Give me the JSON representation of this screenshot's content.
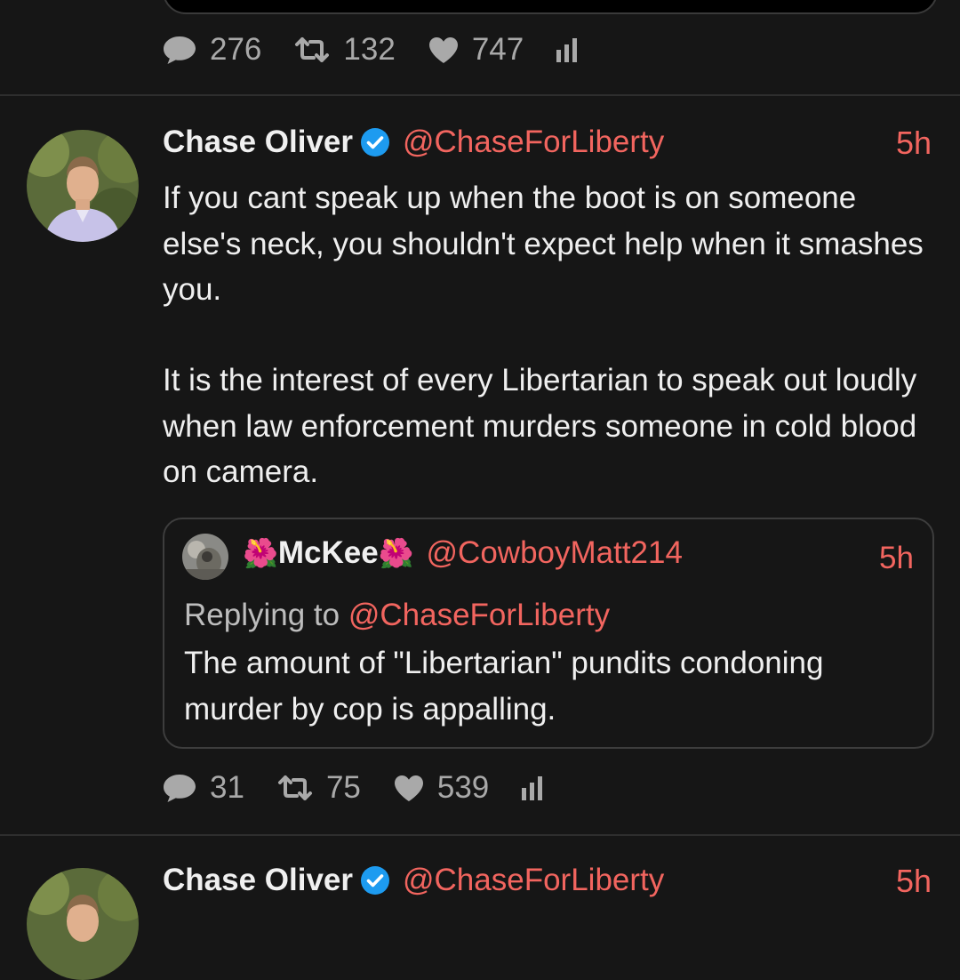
{
  "prev_tweet": {
    "stats": {
      "replies": "276",
      "retweets": "132",
      "likes": "747"
    }
  },
  "tweet": {
    "author_name": "Chase Oliver",
    "handle": "@ChaseForLiberty",
    "time": "5h",
    "verified": true,
    "text_p1": "If you cant speak up when the boot is on someone else's neck, you shouldn't expect help when it smashes you.",
    "text_p2": "It is the interest of every Libertarian to speak out loudly when law enforcement murders someone in cold blood on camera.",
    "quote": {
      "author_name": "McKee",
      "name_emoji": "🌺",
      "handle": "@CowboyMatt214",
      "time": "5h",
      "replying_label": "Replying to",
      "replying_handle": "@ChaseForLiberty",
      "text": "The amount of \"Libertarian\" pundits condoning murder by cop is appalling."
    },
    "stats": {
      "replies": "31",
      "retweets": "75",
      "likes": "539"
    }
  },
  "next_tweet": {
    "author_name": "Chase Oliver",
    "handle": "@ChaseForLiberty",
    "time": "5h"
  },
  "colors": {
    "background": "#161616",
    "accent": "#f2655f",
    "verified": "#1d9bf0",
    "muted": "#a9a9a9"
  },
  "icons": [
    "reply-icon",
    "retweet-icon",
    "like-icon",
    "analytics-icon",
    "verified-badge-icon",
    "hibiscus-emoji"
  ]
}
